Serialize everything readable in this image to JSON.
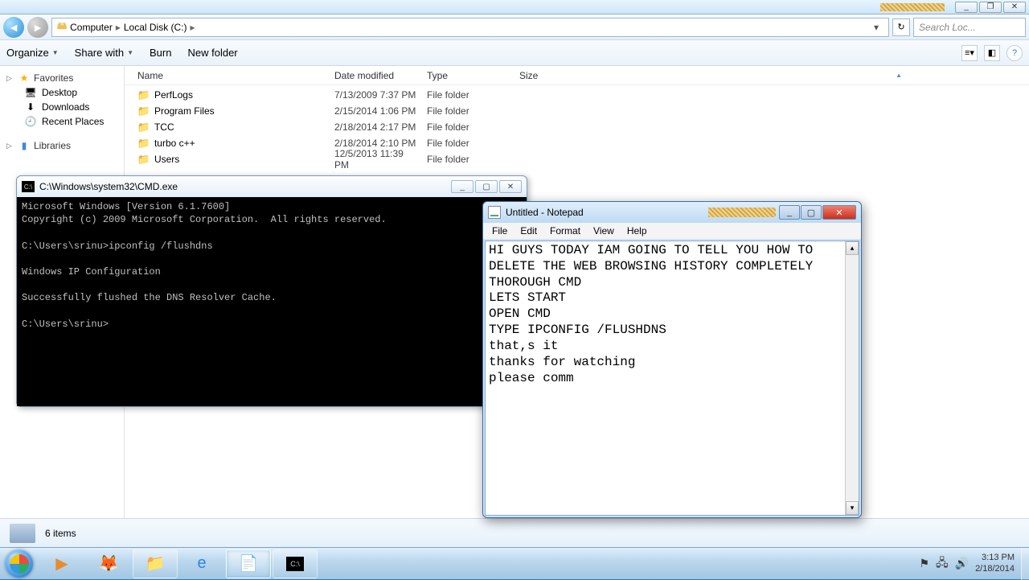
{
  "frame": {
    "min": "_",
    "max": "❐",
    "close": "✕"
  },
  "address": {
    "root": "Computer",
    "path": "Local Disk (C:)",
    "search_placeholder": "Search Loc..."
  },
  "toolbar": {
    "organize": "Organize",
    "share": "Share with",
    "burn": "Burn",
    "newfolder": "New folder"
  },
  "nav": {
    "favorites": "Favorites",
    "desktop": "Desktop",
    "downloads": "Downloads",
    "recent": "Recent Places",
    "libraries": "Libraries"
  },
  "cols": {
    "name": "Name",
    "date": "Date modified",
    "type": "Type",
    "size": "Size"
  },
  "files": [
    {
      "name": "PerfLogs",
      "date": "7/13/2009 7:37 PM",
      "type": "File folder"
    },
    {
      "name": "Program Files",
      "date": "2/15/2014 1:06 PM",
      "type": "File folder"
    },
    {
      "name": "TCC",
      "date": "2/18/2014 2:17 PM",
      "type": "File folder"
    },
    {
      "name": "turbo c++",
      "date": "2/18/2014 2:10 PM",
      "type": "File folder"
    },
    {
      "name": "Users",
      "date": "12/5/2013 11:39 PM",
      "type": "File folder"
    }
  ],
  "status": {
    "count": "6 items"
  },
  "cmd": {
    "title": "C:\\Windows\\system32\\CMD.exe",
    "text": "Microsoft Windows [Version 6.1.7600]\nCopyright (c) 2009 Microsoft Corporation.  All rights reserved.\n\nC:\\Users\\srinu>ipconfig /flushdns\n\nWindows IP Configuration\n\nSuccessfully flushed the DNS Resolver Cache.\n\nC:\\Users\\srinu>"
  },
  "notepad": {
    "title": "Untitled - Notepad",
    "menu": {
      "file": "File",
      "edit": "Edit",
      "format": "Format",
      "view": "View",
      "help": "Help"
    },
    "text": "HI GUYS TODAY IAM GOING TO TELL YOU HOW TO DELETE THE WEB BROWSING HISTORY COMPLETELY THOROUGH CMD\nLETS START\nOPEN CMD\nTYPE IPCONFIG /FLUSHDNS\nthat,s it\nthanks for watching\nplease comm"
  },
  "tray": {
    "time": "3:13 PM",
    "date": "2/18/2014"
  }
}
